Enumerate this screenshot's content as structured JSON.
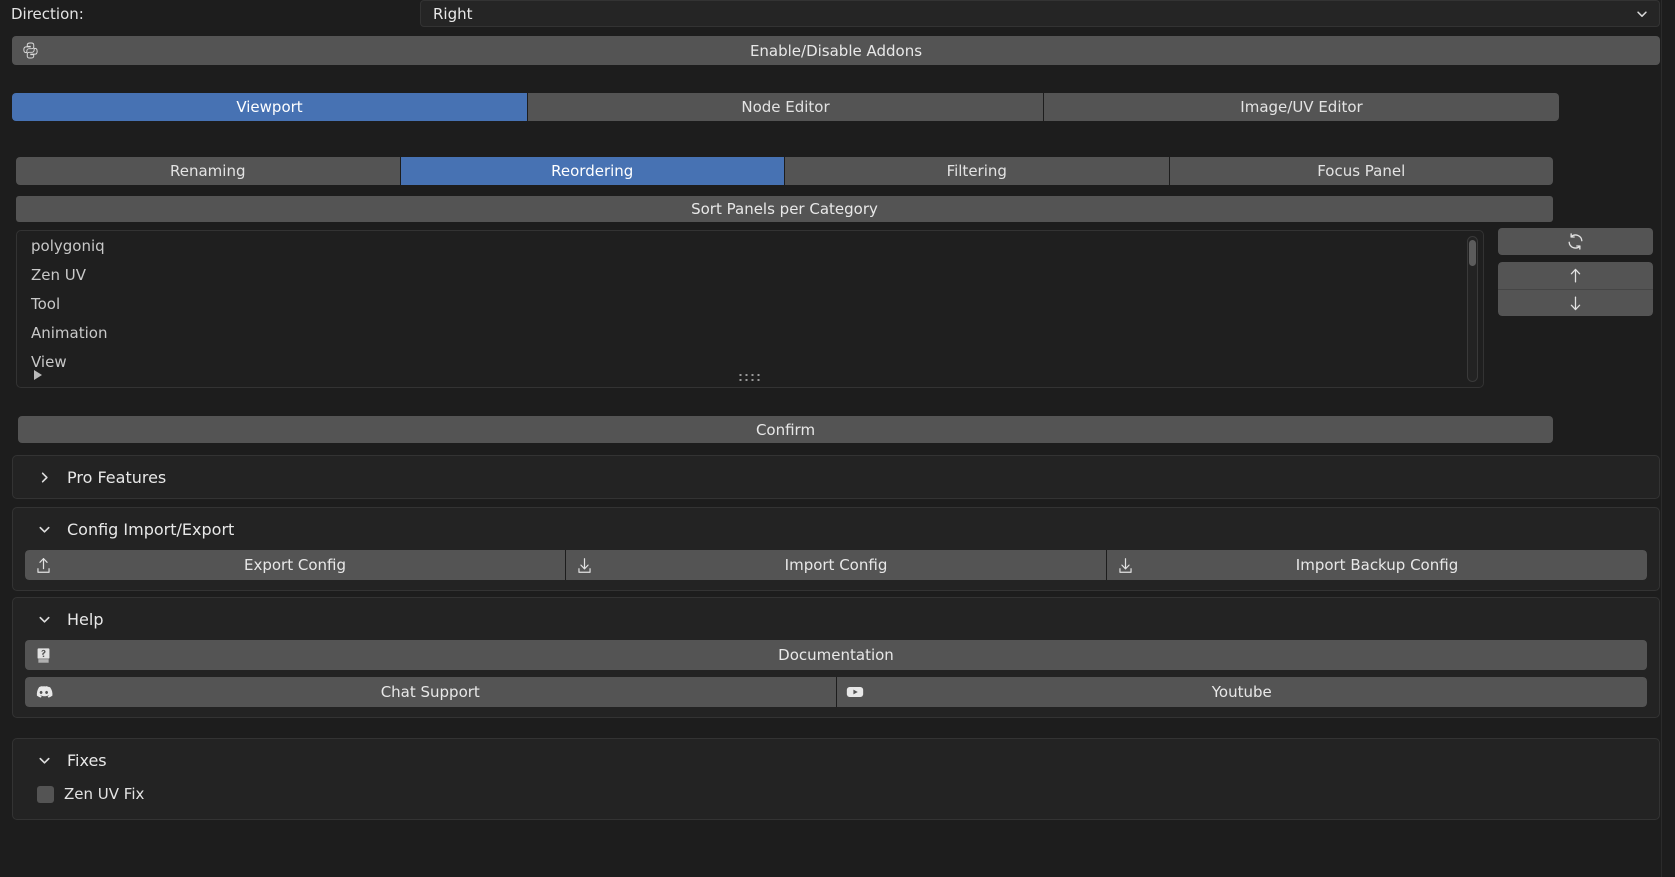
{
  "direction": {
    "label": "Direction:",
    "value": "Right",
    "chevron_icon": "chevron-down-icon"
  },
  "addons_button": {
    "label": "Enable/Disable Addons",
    "icon": "python-logo-icon"
  },
  "editor_tabs": [
    {
      "label": "Viewport",
      "active": true
    },
    {
      "label": "Node Editor",
      "active": false
    },
    {
      "label": "Image/UV Editor",
      "active": false
    }
  ],
  "mode_tabs": [
    {
      "label": "Renaming",
      "active": false
    },
    {
      "label": "Reordering",
      "active": true
    },
    {
      "label": "Filtering",
      "active": false
    },
    {
      "label": "Focus Panel",
      "active": false
    }
  ],
  "sort_header": "Sort Panels per Category",
  "category_list": {
    "items": [
      "polygoniq",
      "Zen UV",
      "Tool",
      "Animation",
      "View"
    ],
    "expand_icon": "triangle-right-icon",
    "grip_icon": "drag-grip-icon",
    "scrollbar_icon": "vertical-scrollbar"
  },
  "side_buttons": [
    {
      "name": "refresh-button",
      "icon": "refresh-icon"
    },
    {
      "name": "move-up-button",
      "icon": "arrow-up-icon"
    },
    {
      "name": "move-down-button",
      "icon": "arrow-down-icon"
    }
  ],
  "confirm_button": {
    "label": "Confirm"
  },
  "panels": {
    "pro_features": {
      "title": "Pro Features",
      "expanded": false,
      "chevron_icon": "chevron-right-icon"
    },
    "config": {
      "title": "Config Import/Export",
      "expanded": true,
      "chevron_icon": "chevron-down-icon",
      "buttons": [
        {
          "label": "Export Config",
          "icon": "upload-icon"
        },
        {
          "label": "Import Config",
          "icon": "download-icon"
        },
        {
          "label": "Import Backup Config",
          "icon": "download-icon"
        }
      ]
    },
    "help": {
      "title": "Help",
      "expanded": true,
      "chevron_icon": "chevron-down-icon",
      "documentation": {
        "label": "Documentation",
        "icon": "manual-question-icon"
      },
      "links": [
        {
          "label": "Chat Support",
          "icon": "discord-icon"
        },
        {
          "label": "Youtube",
          "icon": "youtube-icon"
        }
      ]
    },
    "fixes": {
      "title": "Fixes",
      "expanded": true,
      "chevron_icon": "chevron-down-icon",
      "checkbox": {
        "label": "Zen UV Fix",
        "checked": false
      }
    }
  },
  "colors": {
    "background": "#1d1d1d",
    "panel": "#232323",
    "button": "#545454",
    "accent_blue": "#4772b3",
    "text": "#e3e3e3"
  }
}
